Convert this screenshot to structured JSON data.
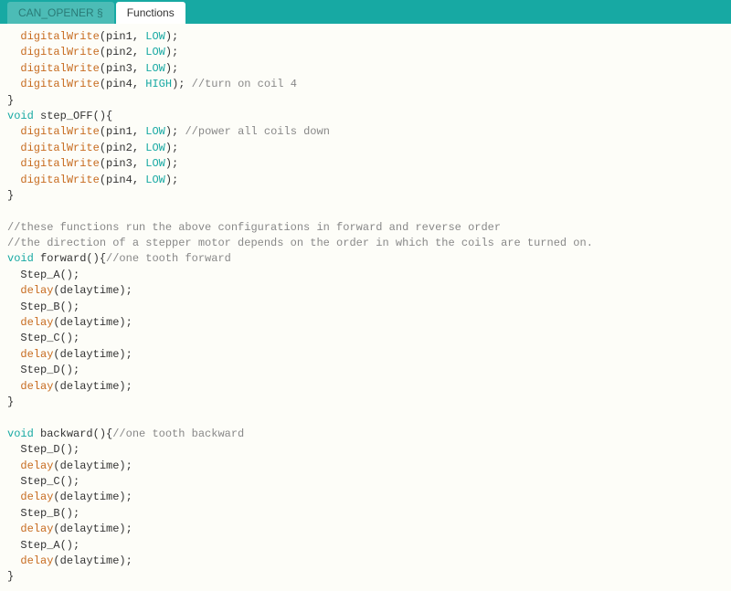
{
  "tabs": [
    {
      "label": "CAN_OPENER §",
      "active": false
    },
    {
      "label": "Functions",
      "active": true
    }
  ],
  "code": {
    "lines": [
      [
        {
          "t": "  "
        },
        {
          "t": "digitalWrite",
          "c": "fn"
        },
        {
          "t": "(pin1, "
        },
        {
          "t": "LOW",
          "c": "const"
        },
        {
          "t": ");"
        }
      ],
      [
        {
          "t": "  "
        },
        {
          "t": "digitalWrite",
          "c": "fn"
        },
        {
          "t": "(pin2, "
        },
        {
          "t": "LOW",
          "c": "const"
        },
        {
          "t": ");"
        }
      ],
      [
        {
          "t": "  "
        },
        {
          "t": "digitalWrite",
          "c": "fn"
        },
        {
          "t": "(pin3, "
        },
        {
          "t": "LOW",
          "c": "const"
        },
        {
          "t": ");"
        }
      ],
      [
        {
          "t": "  "
        },
        {
          "t": "digitalWrite",
          "c": "fn"
        },
        {
          "t": "(pin4, "
        },
        {
          "t": "HIGH",
          "c": "const"
        },
        {
          "t": "); "
        },
        {
          "t": "//turn on coil 4",
          "c": "cm"
        }
      ],
      [
        {
          "t": "}"
        }
      ],
      [
        {
          "t": "void",
          "c": "kw"
        },
        {
          "t": " step_OFF(){"
        }
      ],
      [
        {
          "t": "  "
        },
        {
          "t": "digitalWrite",
          "c": "fn"
        },
        {
          "t": "(pin1, "
        },
        {
          "t": "LOW",
          "c": "const"
        },
        {
          "t": "); "
        },
        {
          "t": "//power all coils down",
          "c": "cm"
        }
      ],
      [
        {
          "t": "  "
        },
        {
          "t": "digitalWrite",
          "c": "fn"
        },
        {
          "t": "(pin2, "
        },
        {
          "t": "LOW",
          "c": "const"
        },
        {
          "t": ");"
        }
      ],
      [
        {
          "t": "  "
        },
        {
          "t": "digitalWrite",
          "c": "fn"
        },
        {
          "t": "(pin3, "
        },
        {
          "t": "LOW",
          "c": "const"
        },
        {
          "t": ");"
        }
      ],
      [
        {
          "t": "  "
        },
        {
          "t": "digitalWrite",
          "c": "fn"
        },
        {
          "t": "(pin4, "
        },
        {
          "t": "LOW",
          "c": "const"
        },
        {
          "t": ");"
        }
      ],
      [
        {
          "t": "}"
        }
      ],
      [
        {
          "t": " "
        }
      ],
      [
        {
          "t": "//these functions run the above configurations in forward and reverse order",
          "c": "cm"
        }
      ],
      [
        {
          "t": "//the direction of a stepper motor depends on the order in which the coils are turned on.",
          "c": "cm"
        }
      ],
      [
        {
          "t": "void",
          "c": "kw"
        },
        {
          "t": " forward(){"
        },
        {
          "t": "//one tooth forward",
          "c": "cm"
        }
      ],
      [
        {
          "t": "  Step_A();"
        }
      ],
      [
        {
          "t": "  "
        },
        {
          "t": "delay",
          "c": "fn"
        },
        {
          "t": "(delaytime);"
        }
      ],
      [
        {
          "t": "  Step_B();"
        }
      ],
      [
        {
          "t": "  "
        },
        {
          "t": "delay",
          "c": "fn"
        },
        {
          "t": "(delaytime);"
        }
      ],
      [
        {
          "t": "  Step_C();"
        }
      ],
      [
        {
          "t": "  "
        },
        {
          "t": "delay",
          "c": "fn"
        },
        {
          "t": "(delaytime);"
        }
      ],
      [
        {
          "t": "  Step_D();"
        }
      ],
      [
        {
          "t": "  "
        },
        {
          "t": "delay",
          "c": "fn"
        },
        {
          "t": "(delaytime);"
        }
      ],
      [
        {
          "t": "}"
        }
      ],
      [
        {
          "t": " "
        }
      ],
      [
        {
          "t": "void",
          "c": "kw"
        },
        {
          "t": " backward(){"
        },
        {
          "t": "//one tooth backward",
          "c": "cm"
        }
      ],
      [
        {
          "t": "  Step_D();"
        }
      ],
      [
        {
          "t": "  "
        },
        {
          "t": "delay",
          "c": "fn"
        },
        {
          "t": "(delaytime);"
        }
      ],
      [
        {
          "t": "  Step_C();"
        }
      ],
      [
        {
          "t": "  "
        },
        {
          "t": "delay",
          "c": "fn"
        },
        {
          "t": "(delaytime);"
        }
      ],
      [
        {
          "t": "  Step_B();"
        }
      ],
      [
        {
          "t": "  "
        },
        {
          "t": "delay",
          "c": "fn"
        },
        {
          "t": "(delaytime);"
        }
      ],
      [
        {
          "t": "  Step_A();"
        }
      ],
      [
        {
          "t": "  "
        },
        {
          "t": "delay",
          "c": "fn"
        },
        {
          "t": "(delaytime);"
        }
      ],
      [
        {
          "t": "}"
        }
      ]
    ]
  }
}
